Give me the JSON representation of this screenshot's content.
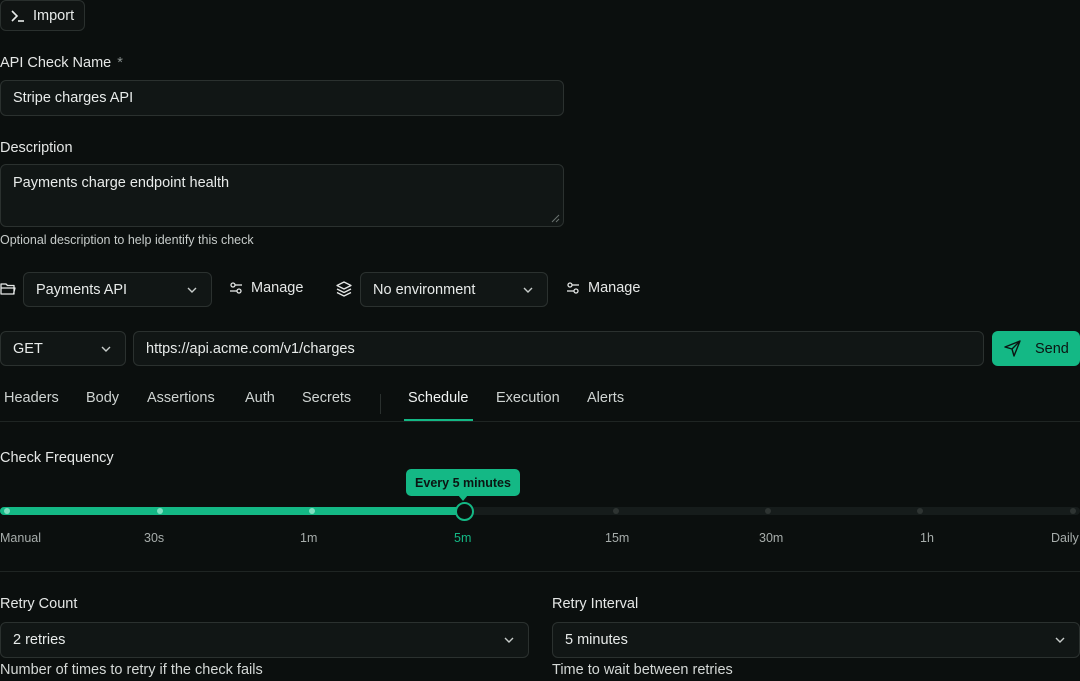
{
  "import_button": {
    "label": "Import",
    "icon": "terminal-icon"
  },
  "check_name": {
    "label": "API Check Name",
    "required_mark": "*",
    "value": "Stripe charges API"
  },
  "description": {
    "label": "Description",
    "value": "Payments charge endpoint health",
    "hint": "Optional description to help identify this check"
  },
  "group": {
    "icon": "folder-icon",
    "selected": "Payments API",
    "manage_label": "Manage"
  },
  "environment": {
    "icon": "layers-icon",
    "selected": "No environment",
    "manage_label": "Manage"
  },
  "request": {
    "method": "GET",
    "url": "https://api.acme.com/v1/charges",
    "send_label": "Send"
  },
  "tabs": [
    {
      "label": "Headers"
    },
    {
      "label": "Body"
    },
    {
      "label": "Assertions"
    },
    {
      "label": "Auth"
    },
    {
      "label": "Secrets"
    },
    {
      "label": "Schedule",
      "active": true
    },
    {
      "label": "Execution"
    },
    {
      "label": "Alerts"
    }
  ],
  "schedule": {
    "title": "Check Frequency",
    "tooltip": "Every 5 minutes",
    "selected_index": 3,
    "ticks": [
      "Manual",
      "30s",
      "1m",
      "5m",
      "15m",
      "30m",
      "1h",
      "Daily"
    ]
  },
  "retry_count": {
    "label": "Retry Count",
    "value": "2 retries",
    "hint": "Number of times to retry if the check fails"
  },
  "retry_interval": {
    "label": "Retry Interval",
    "value": "5 minutes",
    "hint": "Time to wait between retries"
  },
  "colors": {
    "accent": "#14b885",
    "background": "#0b0f0e",
    "field": "#111615",
    "border": "#2b312f"
  }
}
